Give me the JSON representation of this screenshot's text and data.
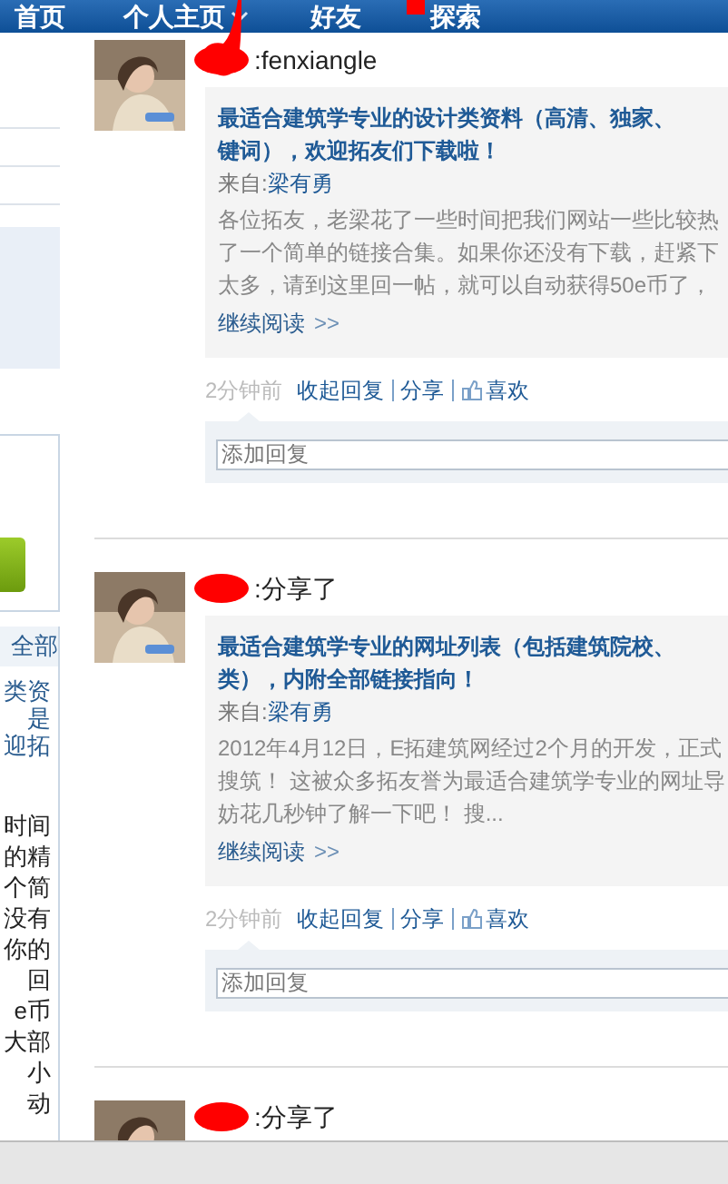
{
  "nav": [
    {
      "label": "首页",
      "has_menu": false
    },
    {
      "label": "个人主页",
      "has_menu": true
    },
    {
      "label": "好友",
      "has_menu": false
    },
    {
      "label": "探索",
      "has_menu": false
    }
  ],
  "sidebar": {
    "link_lines": [
      "类资",
      "是",
      "迎拓"
    ],
    "header": "全部",
    "text_lines": [
      "时间",
      "的精",
      "个简",
      "没有",
      "你的",
      "回",
      "e币",
      "大部",
      "小",
      "动"
    ]
  },
  "posts": [
    {
      "action": ":fenxiangle",
      "title_lines": [
        "最适合建筑学专业的设计类资料（高清、独家、",
        "键词），欢迎拓友们下载啦！"
      ],
      "source_label": "来自:",
      "source": "梁有勇",
      "body_lines": [
        "各位拓友，老梁花了一些时间把我们网站一些比较热",
        "了一个简单的链接合集。如果你还没有下载，赶紧下",
        "太多，请到这里回一帖，就可以自动获得50e币了，"
      ],
      "more": "继续阅读",
      "more_arrow": ">>",
      "time": "2分钟前",
      "actions": [
        "收起回复",
        "分享",
        "喜欢"
      ],
      "reply_placeholder": "添加回复"
    },
    {
      "action": ":分享了",
      "title_lines": [
        "最适合建筑学专业的网址列表（包括建筑院校、",
        "类），内附全部链接指向！"
      ],
      "source_label": "来自:",
      "source": "梁有勇",
      "body_lines": [
        "2012年4月12日，E拓建筑网经过2个月的开发，正式",
        "搜筑！ 这被众多拓友誉为最适合建筑学专业的网址导",
        "妨花几秒钟了解一下吧！ 搜..."
      ],
      "more": "继续阅读",
      "more_arrow": ">>",
      "time": "2分钟前",
      "actions": [
        "收起回复",
        "分享",
        "喜欢"
      ],
      "reply_placeholder": "添加回复"
    },
    {
      "action": ":分享了"
    }
  ]
}
